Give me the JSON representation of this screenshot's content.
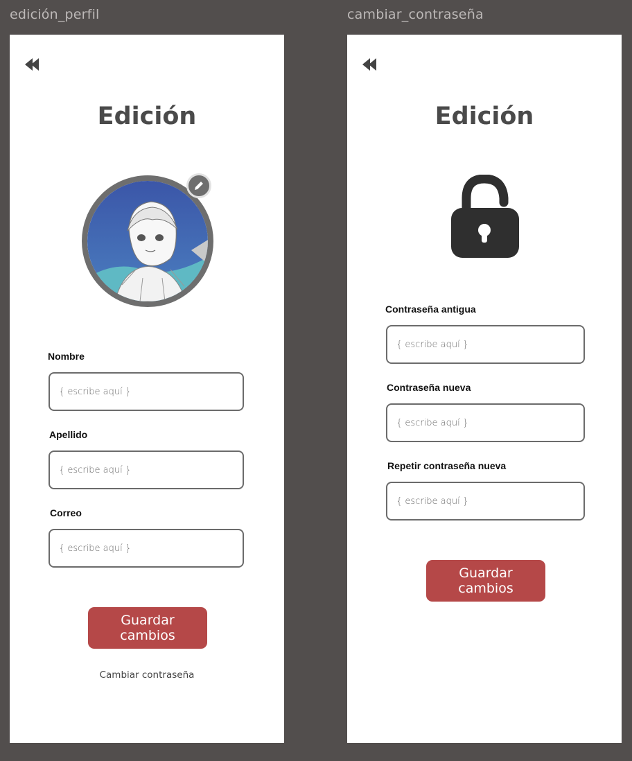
{
  "frames": {
    "perfil": {
      "label": "edición_perfil",
      "title": "Edición",
      "fields": [
        {
          "label": "Nombre",
          "placeholder": "{ escribe aquí }"
        },
        {
          "label": "Apellido",
          "placeholder": "{ escribe aquí }"
        },
        {
          "label": "Correo",
          "placeholder": "{ escribe aquí }"
        }
      ],
      "save_label": "Guardar cambios",
      "change_password_link": "Cambiar contraseña",
      "icons": {
        "back": "double-chevron-left-icon",
        "edit": "pencil-icon"
      }
    },
    "pass": {
      "label": "cambiar_contraseña",
      "title": "Edición",
      "fields": [
        {
          "label": "Contraseña antigua",
          "placeholder": "{ escribe aquí }"
        },
        {
          "label": "Contraseña nueva",
          "placeholder": "{ escribe aquí }"
        },
        {
          "label": "Repetir contraseña nueva",
          "placeholder": "{ escribe aquí }"
        }
      ],
      "save_label": "Guardar cambios",
      "icons": {
        "back": "double-chevron-left-icon",
        "lock": "unlocked-padlock-icon"
      }
    }
  },
  "colors": {
    "canvas": "#524e4d",
    "screen": "#ffffff",
    "accent": "#b54848",
    "border": "#6b6b6b",
    "title": "#4a4a4a"
  }
}
